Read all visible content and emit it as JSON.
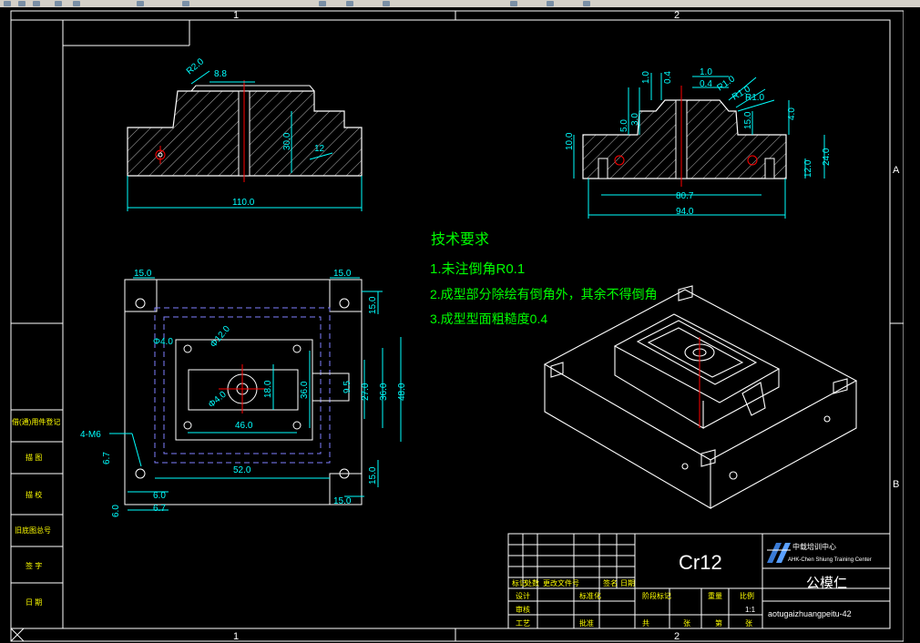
{
  "frame": {
    "zone_top": [
      "1",
      "2"
    ],
    "zone_bottom": [
      "1",
      "2"
    ],
    "zone_right": [
      "A",
      "B"
    ]
  },
  "notes": {
    "title": "技术要求",
    "lines": [
      "1.未注倒角R0.1",
      "2.成型部分除绘有倒角外，其余不得倒角",
      "3.成型型面粗糙度0.4"
    ]
  },
  "left_section": {
    "dims": [
      "R2.0",
      "8.8",
      "30.0",
      "12",
      "110.0"
    ]
  },
  "right_section": {
    "dims": [
      "1.0",
      "0.4",
      "1.0",
      "0.4",
      "R1.0",
      "R1.0",
      "R1.0",
      "5.0",
      "3.0",
      "10.0",
      "15.0",
      "4.0",
      "24.0",
      "12.0",
      "80.7",
      "94.0"
    ]
  },
  "plan_view": {
    "dims": [
      "15.0",
      "15.0",
      "15.0",
      "Φ4.0",
      "Φ12.0",
      "36.0",
      "18.0",
      "27.0",
      "36.0",
      "48.0",
      "9.5",
      "Φ4.0",
      "46.0",
      "52.0",
      "4-M6",
      "6.7",
      "6.0",
      "6.0",
      "6.7",
      "15.0",
      "15.0"
    ]
  },
  "title_block": {
    "material": "Cr12",
    "org_cn": "中载培训中心",
    "org_en": "AHK-Chen Shiung Training Center",
    "part_name": "公模仁",
    "drawing_no": "aotugaizhuangpeitu-42",
    "scale": "1:1",
    "grid_labels": [
      "标记",
      "处数",
      "更改文件号",
      "签名",
      "日期",
      "设计",
      "标准化",
      "阶段标记",
      "重量",
      "比例",
      "审核",
      "工艺",
      "批准",
      "共",
      "张",
      "第",
      "张"
    ]
  },
  "side_table": {
    "labels": [
      "借(通)用件登记",
      "描 图",
      "描 校",
      "旧底图总号",
      "签 字",
      "日 期"
    ]
  },
  "colors": {
    "background": "#000000",
    "frame": "#ffffff",
    "dimension": "#00ffff",
    "center_line": "#ff0000",
    "hidden_line": "#8080ff",
    "notes": "#00ff00",
    "table_text": "#ffff00"
  }
}
